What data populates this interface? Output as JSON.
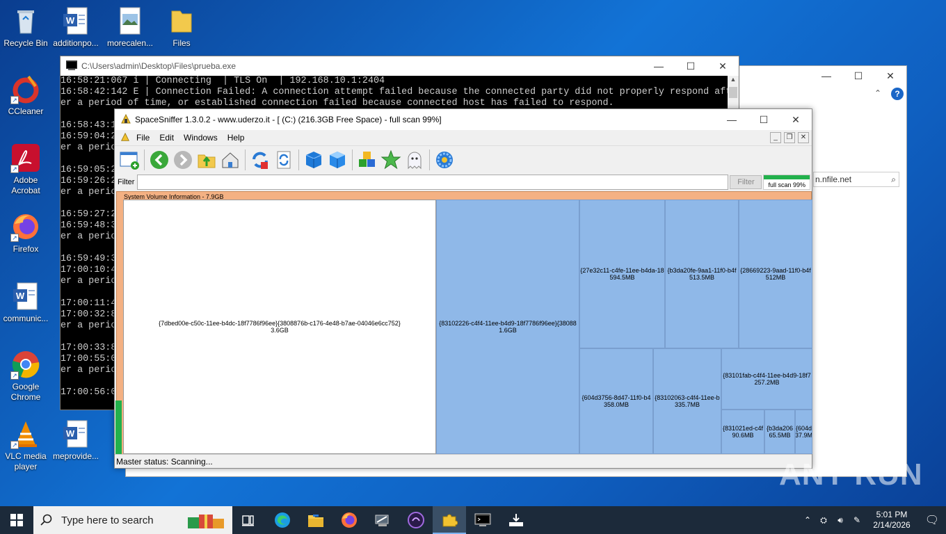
{
  "desktop": {
    "icons": [
      {
        "label": "Recycle Bin"
      },
      {
        "label": "additionpo..."
      },
      {
        "label": "morecalen..."
      },
      {
        "label": "Files"
      },
      {
        "label": "CCleaner"
      },
      {
        "label": "Adobe Acrobat"
      },
      {
        "label": "Firefox"
      },
      {
        "label": "communic..."
      },
      {
        "label": "Google Chrome"
      },
      {
        "label": "VLC media player"
      },
      {
        "label": "meprovide..."
      }
    ]
  },
  "bg_window": {
    "search_text": "n.nfile.net",
    "help_label": "?"
  },
  "console": {
    "title": "C:\\Users\\admin\\Desktop\\Files\\prueba.exe",
    "lines": [
      "16:58:21:067 i | Connecting  | TLS On  | 192.168.10.1:2404",
      "16:58:42:142 E | Connection Failed: A connection attempt failed because the connected party did not properly respond aft",
      "er a period of time, or established connection failed because connected host has failed to respond.",
      "",
      "16:58:43:1",
      "16:59:04:2",
      "er a perio",
      "",
      "16:59:05:2",
      "16:59:26:2",
      "er a perio",
      "",
      "16:59:27:2",
      "16:59:48:3",
      "er a perio",
      "",
      "16:59:49:3",
      "17:00:10:4",
      "er a perio",
      "",
      "17:00:11:4",
      "17:00:32:8",
      "er a perio",
      "",
      "17:00:33:8",
      "17:00:55:0",
      "er a perio",
      "",
      "17:00:56:0"
    ]
  },
  "spacesniffer": {
    "title": "SpaceSniffer 1.3.0.2 - www.uderzo.it - [ (C:) (216.3GB Free Space) - full scan 99%]",
    "menu": [
      "File",
      "Edit",
      "Windows",
      "Help"
    ],
    "filter_label": "Filter",
    "filter_value": "",
    "filter_button": "Filter",
    "progress_label": "full scan 99%",
    "progress_value": 0.99,
    "treemap_header": "System Volume Information - 7.9GB",
    "cells": [
      {
        "name": "{7dbed00e-c50c-11ee-b4dc-18f7786f96ee}{3808876b-c176-4e48-b7ae-04046e6cc752}",
        "size": "3.6GB"
      },
      {
        "name": "{83102226-c4f4-11ee-b4d9-18f7786f96ee}{38088",
        "size": "1.6GB"
      },
      {
        "name": "{27e32c11-c4fe-11ee-b4da-18",
        "size": "594.5MB"
      },
      {
        "name": "{b3da20fe-9aa1-11f0-b4f",
        "size": "513.5MB"
      },
      {
        "name": "{28669223-9aad-11f0-b4f",
        "size": "512MB"
      },
      {
        "name": "{604d3756-8d47-11f0-b4",
        "size": "358.0MB"
      },
      {
        "name": "{83102063-c4f4-11ee-b",
        "size": "335.7MB"
      },
      {
        "name": "{83101fab-c4f4-11ee-b4d9-18f7",
        "size": "257.2MB"
      },
      {
        "name": "{831021ed-c4f",
        "size": "90.6MB"
      },
      {
        "name": "{b3da206",
        "size": "65.5MB"
      },
      {
        "name": "{604d",
        "size": "37.9M"
      }
    ],
    "status": "Master status: Scanning..."
  },
  "taskbar": {
    "search_placeholder": "Type here to search",
    "time": "5:01 PM",
    "date": "2/14/2026"
  },
  "watermark": "ANY RUN",
  "colors": {
    "treemap_cell": "#8fb8e8",
    "treemap_bg": "#f4b183",
    "progress": "#22b14c",
    "taskbar": "#1c2a3a"
  }
}
